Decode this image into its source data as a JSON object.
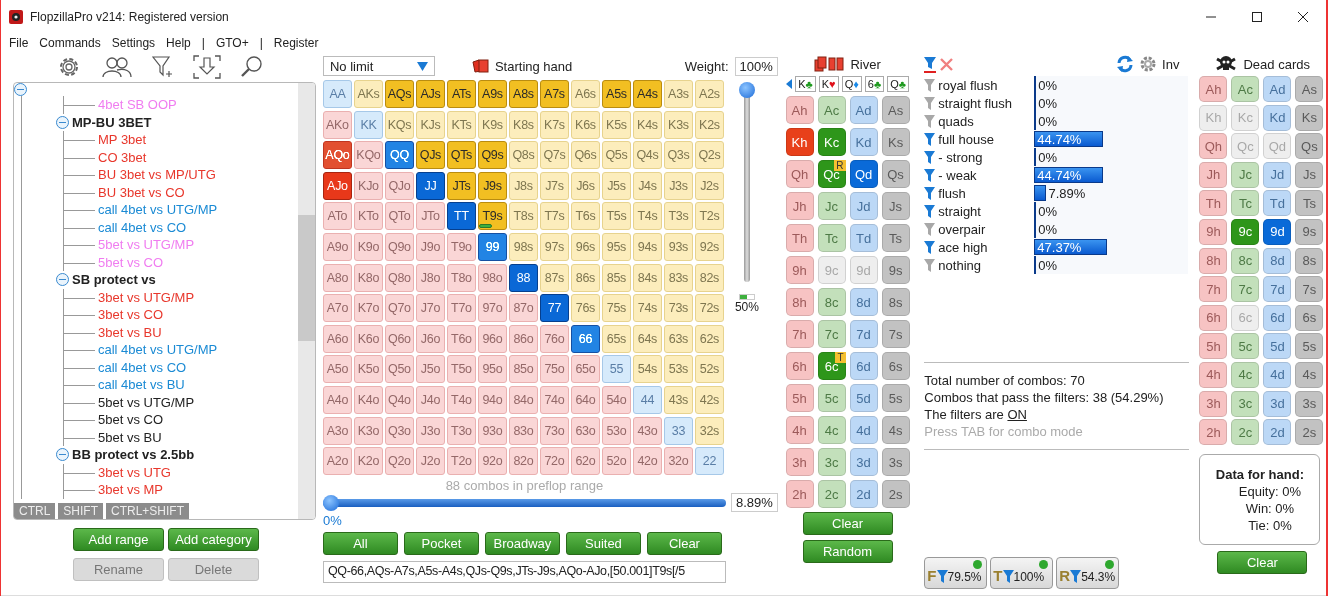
{
  "window": {
    "title": "FlopzillaPro v214: Registered version"
  },
  "menu": [
    "File",
    "Commands",
    "Settings",
    "Help",
    "|",
    "GTO+",
    "|",
    "Register"
  ],
  "tree": {
    "expanded": true,
    "children": [
      {
        "children": [
          {
            "label": "4bet SB OOP",
            "color": "#f07cf0"
          }
        ]
      },
      {
        "label": "MP-BU 3BET",
        "expanded": true,
        "children": [
          {
            "label": "MP 3bet",
            "color": "#e8372c"
          },
          {
            "label": "CO 3bet",
            "color": "#e8372c"
          },
          {
            "label": "BU 3bet vs MP/UTG",
            "color": "#e8372c"
          },
          {
            "label": "BU 3bet vs CO",
            "color": "#e8372c"
          },
          {
            "label": "call 4bet vs UTG/MP",
            "color": "#1a8ad4"
          },
          {
            "label": "call 4bet vs CO",
            "color": "#1a8ad4"
          },
          {
            "label": "5bet vs UTG/MP",
            "color": "#f07cf0"
          },
          {
            "label": "5bet vs CO",
            "color": "#f07cf0"
          }
        ]
      },
      {
        "label": "SB protect vs",
        "expanded": true,
        "children": [
          {
            "label": "3bet vs UTG/MP",
            "color": "#e8372c"
          },
          {
            "label": "3bet vs CO",
            "color": "#e8372c"
          },
          {
            "label": "3bet vs BU",
            "color": "#e8372c"
          },
          {
            "label": "call 4bet vs UTG/MP",
            "color": "#1a8ad4"
          },
          {
            "label": "call 4bet vs CO",
            "color": "#1a8ad4"
          },
          {
            "label": "call 4bet vs BU",
            "color": "#1a8ad4"
          },
          {
            "label": "5bet vs UTG/MP",
            "color": "#222222"
          },
          {
            "label": "5bet vs CO",
            "color": "#222222"
          },
          {
            "label": "5bet vs BU",
            "color": "#222222"
          }
        ]
      },
      {
        "label": "BB protect vs 2.5bb",
        "expanded": true,
        "children": [
          {
            "label": "3bet vs UTG",
            "color": "#e8372c"
          },
          {
            "label": "3bet vs MP",
            "color": "#e8372c"
          }
        ]
      }
    ]
  },
  "modifier_tabs": [
    "CTRL",
    "SHIFT",
    "CTRL+SHIFT"
  ],
  "tree_buttons": [
    {
      "label": "Add range",
      "disabled": false
    },
    {
      "label": "Add category",
      "disabled": false
    },
    {
      "label": "Rename",
      "disabled": true
    },
    {
      "label": "Delete",
      "disabled": true
    }
  ],
  "game_select": {
    "value": "No limit"
  },
  "starting_hand_label": "Starting hand",
  "weight": {
    "label": "Weight:",
    "value": "100%"
  },
  "weight_slider": {
    "level": 1
  },
  "weight_mini": {
    "level": 0.5,
    "reading": "50%"
  },
  "hand_grid": [
    [
      {
        "label": "AA",
        "selected": false,
        "partial": false
      },
      {
        "label": "AKs",
        "selected": false,
        "partial": false
      },
      {
        "label": "AQs",
        "selected": true,
        "partial": false
      },
      {
        "label": "AJs",
        "selected": true,
        "partial": false
      },
      {
        "label": "ATs",
        "selected": true,
        "partial": false
      },
      {
        "label": "A9s",
        "selected": true,
        "partial": false
      },
      {
        "label": "A8s",
        "selected": true,
        "partial": false
      },
      {
        "label": "A7s",
        "selected": true,
        "partial": false
      },
      {
        "label": "A6s",
        "selected": false,
        "partial": false
      },
      {
        "label": "A5s",
        "selected": true,
        "partial": false
      },
      {
        "label": "A4s",
        "selected": true,
        "partial": false
      },
      {
        "label": "A3s",
        "selected": false,
        "partial": false
      },
      {
        "label": "A2s",
        "selected": false,
        "partial": false
      }
    ],
    [
      {
        "label": "AKo",
        "selected": false,
        "partial": false
      },
      {
        "label": "KK",
        "selected": false,
        "partial": false
      },
      {
        "label": "KQs",
        "selected": false,
        "partial": false
      },
      {
        "label": "KJs",
        "selected": false,
        "partial": false
      },
      {
        "label": "KTs",
        "selected": false,
        "partial": false
      },
      {
        "label": "K9s",
        "selected": false,
        "partial": false
      },
      {
        "label": "K8s",
        "selected": false,
        "partial": false
      },
      {
        "label": "K7s",
        "selected": false,
        "partial": false
      },
      {
        "label": "K6s",
        "selected": false,
        "partial": false
      },
      {
        "label": "K5s",
        "selected": false,
        "partial": false
      },
      {
        "label": "K4s",
        "selected": false,
        "partial": false
      },
      {
        "label": "K3s",
        "selected": false,
        "partial": false
      },
      {
        "label": "K2s",
        "selected": false,
        "partial": false
      }
    ],
    [
      {
        "label": "AQo",
        "selected": true,
        "partial": true
      },
      {
        "label": "KQo",
        "selected": false,
        "partial": false
      },
      {
        "label": "QQ",
        "selected": true,
        "partial": true
      },
      {
        "label": "QJs",
        "selected": true,
        "partial": false
      },
      {
        "label": "QTs",
        "selected": true,
        "partial": false
      },
      {
        "label": "Q9s",
        "selected": true,
        "partial": false
      },
      {
        "label": "Q8s",
        "selected": false,
        "partial": false
      },
      {
        "label": "Q7s",
        "selected": false,
        "partial": false
      },
      {
        "label": "Q6s",
        "selected": false,
        "partial": false
      },
      {
        "label": "Q5s",
        "selected": false,
        "partial": false
      },
      {
        "label": "Q4s",
        "selected": false,
        "partial": false
      },
      {
        "label": "Q3s",
        "selected": false,
        "partial": false
      },
      {
        "label": "Q2s",
        "selected": false,
        "partial": false
      }
    ],
    [
      {
        "label": "AJo",
        "selected": true,
        "partial": false
      },
      {
        "label": "KJo",
        "selected": false,
        "partial": false
      },
      {
        "label": "QJo",
        "selected": false,
        "partial": false
      },
      {
        "label": "JJ",
        "selected": true,
        "partial": false
      },
      {
        "label": "JTs",
        "selected": true,
        "partial": false
      },
      {
        "label": "J9s",
        "selected": true,
        "partial": false
      },
      {
        "label": "J8s",
        "selected": false,
        "partial": false
      },
      {
        "label": "J7s",
        "selected": false,
        "partial": false
      },
      {
        "label": "J6s",
        "selected": false,
        "partial": false
      },
      {
        "label": "J5s",
        "selected": false,
        "partial": false
      },
      {
        "label": "J4s",
        "selected": false,
        "partial": false
      },
      {
        "label": "J3s",
        "selected": false,
        "partial": false
      },
      {
        "label": "J2s",
        "selected": false,
        "partial": false
      }
    ],
    [
      {
        "label": "ATo",
        "selected": false,
        "partial": false
      },
      {
        "label": "KTo",
        "selected": false,
        "partial": false
      },
      {
        "label": "QTo",
        "selected": false,
        "partial": false
      },
      {
        "label": "JTo",
        "selected": false,
        "partial": false
      },
      {
        "label": "TT",
        "selected": true,
        "partial": false
      },
      {
        "label": "T9s",
        "selected": true,
        "partial": false,
        "level": 0.5
      },
      {
        "label": "T8s",
        "selected": false,
        "partial": false
      },
      {
        "label": "T7s",
        "selected": false,
        "partial": false
      },
      {
        "label": "T6s",
        "selected": false,
        "partial": false
      },
      {
        "label": "T5s",
        "selected": false,
        "partial": false
      },
      {
        "label": "T4s",
        "selected": false,
        "partial": false
      },
      {
        "label": "T3s",
        "selected": false,
        "partial": false
      },
      {
        "label": "T2s",
        "selected": false,
        "partial": false
      }
    ],
    [
      {
        "label": "A9o",
        "selected": false,
        "partial": false
      },
      {
        "label": "K9o",
        "selected": false,
        "partial": false
      },
      {
        "label": "Q9o",
        "selected": false,
        "partial": false
      },
      {
        "label": "J9o",
        "selected": false,
        "partial": false
      },
      {
        "label": "T9o",
        "selected": false,
        "partial": false
      },
      {
        "label": "99",
        "selected": true,
        "partial": true
      },
      {
        "label": "98s",
        "selected": false,
        "partial": false
      },
      {
        "label": "97s",
        "selected": false,
        "partial": false
      },
      {
        "label": "96s",
        "selected": false,
        "partial": false
      },
      {
        "label": "95s",
        "selected": false,
        "partial": false
      },
      {
        "label": "94s",
        "selected": false,
        "partial": false
      },
      {
        "label": "93s",
        "selected": false,
        "partial": false
      },
      {
        "label": "92s",
        "selected": false,
        "partial": false
      }
    ],
    [
      {
        "label": "A8o",
        "selected": false,
        "partial": false
      },
      {
        "label": "K8o",
        "selected": false,
        "partial": false
      },
      {
        "label": "Q8o",
        "selected": false,
        "partial": false
      },
      {
        "label": "J8o",
        "selected": false,
        "partial": false
      },
      {
        "label": "T8o",
        "selected": false,
        "partial": false
      },
      {
        "label": "98o",
        "selected": false,
        "partial": false
      },
      {
        "label": "88",
        "selected": true,
        "partial": false
      },
      {
        "label": "87s",
        "selected": false,
        "partial": false
      },
      {
        "label": "86s",
        "selected": false,
        "partial": false
      },
      {
        "label": "85s",
        "selected": false,
        "partial": false
      },
      {
        "label": "84s",
        "selected": false,
        "partial": false
      },
      {
        "label": "83s",
        "selected": false,
        "partial": false
      },
      {
        "label": "82s",
        "selected": false,
        "partial": false
      }
    ],
    [
      {
        "label": "A7o",
        "selected": false,
        "partial": false
      },
      {
        "label": "K7o",
        "selected": false,
        "partial": false
      },
      {
        "label": "Q7o",
        "selected": false,
        "partial": false
      },
      {
        "label": "J7o",
        "selected": false,
        "partial": false
      },
      {
        "label": "T7o",
        "selected": false,
        "partial": false
      },
      {
        "label": "97o",
        "selected": false,
        "partial": false
      },
      {
        "label": "87o",
        "selected": false,
        "partial": false
      },
      {
        "label": "77",
        "selected": true,
        "partial": false
      },
      {
        "label": "76s",
        "selected": false,
        "partial": false
      },
      {
        "label": "75s",
        "selected": false,
        "partial": false
      },
      {
        "label": "74s",
        "selected": false,
        "partial": false
      },
      {
        "label": "73s",
        "selected": false,
        "partial": false
      },
      {
        "label": "72s",
        "selected": false,
        "partial": false
      }
    ],
    [
      {
        "label": "A6o",
        "selected": false,
        "partial": false
      },
      {
        "label": "K6o",
        "selected": false,
        "partial": false
      },
      {
        "label": "Q6o",
        "selected": false,
        "partial": false
      },
      {
        "label": "J6o",
        "selected": false,
        "partial": false
      },
      {
        "label": "T6o",
        "selected": false,
        "partial": false
      },
      {
        "label": "96o",
        "selected": false,
        "partial": false
      },
      {
        "label": "86o",
        "selected": false,
        "partial": false
      },
      {
        "label": "76o",
        "selected": false,
        "partial": false
      },
      {
        "label": "66",
        "selected": true,
        "partial": true
      },
      {
        "label": "65s",
        "selected": false,
        "partial": false
      },
      {
        "label": "64s",
        "selected": false,
        "partial": false
      },
      {
        "label": "63s",
        "selected": false,
        "partial": false
      },
      {
        "label": "62s",
        "selected": false,
        "partial": false
      }
    ],
    [
      {
        "label": "A5o",
        "selected": false,
        "partial": false
      },
      {
        "label": "K5o",
        "selected": false,
        "partial": false
      },
      {
        "label": "Q5o",
        "selected": false,
        "partial": false
      },
      {
        "label": "J5o",
        "selected": false,
        "partial": false
      },
      {
        "label": "T5o",
        "selected": false,
        "partial": false
      },
      {
        "label": "95o",
        "selected": false,
        "partial": false
      },
      {
        "label": "85o",
        "selected": false,
        "partial": false
      },
      {
        "label": "75o",
        "selected": false,
        "partial": false
      },
      {
        "label": "65o",
        "selected": false,
        "partial": false
      },
      {
        "label": "55",
        "selected": false,
        "partial": false
      },
      {
        "label": "54s",
        "selected": false,
        "partial": false
      },
      {
        "label": "53s",
        "selected": false,
        "partial": false
      },
      {
        "label": "52s",
        "selected": false,
        "partial": false
      }
    ],
    [
      {
        "label": "A4o",
        "selected": false,
        "partial": false
      },
      {
        "label": "K4o",
        "selected": false,
        "partial": false
      },
      {
        "label": "Q4o",
        "selected": false,
        "partial": false
      },
      {
        "label": "J4o",
        "selected": false,
        "partial": false
      },
      {
        "label": "T4o",
        "selected": false,
        "partial": false
      },
      {
        "label": "94o",
        "selected": false,
        "partial": false
      },
      {
        "label": "84o",
        "selected": false,
        "partial": false
      },
      {
        "label": "74o",
        "selected": false,
        "partial": false
      },
      {
        "label": "64o",
        "selected": false,
        "partial": false
      },
      {
        "label": "54o",
        "selected": false,
        "partial": false
      },
      {
        "label": "44",
        "selected": false,
        "partial": false
      },
      {
        "label": "43s",
        "selected": false,
        "partial": false
      },
      {
        "label": "42s",
        "selected": false,
        "partial": false
      }
    ],
    [
      {
        "label": "A3o",
        "selected": false,
        "partial": false
      },
      {
        "label": "K3o",
        "selected": false,
        "partial": false
      },
      {
        "label": "Q3o",
        "selected": false,
        "partial": false
      },
      {
        "label": "J3o",
        "selected": false,
        "partial": false
      },
      {
        "label": "T3o",
        "selected": false,
        "partial": false
      },
      {
        "label": "93o",
        "selected": false,
        "partial": false
      },
      {
        "label": "83o",
        "selected": false,
        "partial": false
      },
      {
        "label": "73o",
        "selected": false,
        "partial": false
      },
      {
        "label": "63o",
        "selected": false,
        "partial": false
      },
      {
        "label": "53o",
        "selected": false,
        "partial": false
      },
      {
        "label": "43o",
        "selected": false,
        "partial": false
      },
      {
        "label": "33",
        "selected": false,
        "partial": false
      },
      {
        "label": "32s",
        "selected": false,
        "partial": false
      }
    ],
    [
      {
        "label": "A2o",
        "selected": false,
        "partial": false
      },
      {
        "label": "K2o",
        "selected": false,
        "partial": false
      },
      {
        "label": "Q2o",
        "selected": false,
        "partial": false
      },
      {
        "label": "J2o",
        "selected": false,
        "partial": false
      },
      {
        "label": "T2o",
        "selected": false,
        "partial": false
      },
      {
        "label": "92o",
        "selected": false,
        "partial": false
      },
      {
        "label": "82o",
        "selected": false,
        "partial": false
      },
      {
        "label": "72o",
        "selected": false,
        "partial": false
      },
      {
        "label": "62o",
        "selected": false,
        "partial": false
      },
      {
        "label": "52o",
        "selected": false,
        "partial": false
      },
      {
        "label": "42o",
        "selected": false,
        "partial": false
      },
      {
        "label": "32o",
        "selected": false,
        "partial": false
      },
      {
        "label": "22",
        "selected": false,
        "partial": false
      }
    ]
  ],
  "range_caption": "88 combos in preflop range",
  "range_slider": {
    "level": 0,
    "min_label": "0%",
    "value": "8.89%"
  },
  "range_buttons": [
    "All",
    "Pocket",
    "Broadway",
    "Suited",
    "Clear"
  ],
  "range_text": "QQ-66,AQs-A7s,A5s-A4s,QJs-Q9s,JTs-J9s,AQo-AJo,[50.001]T9s[/5",
  "board": {
    "street": "River",
    "slots": [
      {
        "rank": "K",
        "suit": "♣",
        "color": "#1f9a1f"
      },
      {
        "rank": "K",
        "suit": "♥",
        "color": "#e0101a"
      },
      {
        "rank": "Q",
        "suit": "♦",
        "color": "#1a8ae8"
      },
      {
        "rank": "6",
        "suit": "♣",
        "color": "#1f9a1f"
      },
      {
        "rank": "Q",
        "suit": "♣",
        "color": "#1f9a1f"
      }
    ],
    "rows": [
      [
        {
          "label": "Ah",
          "selected": false,
          "disabled": false
        },
        {
          "label": "Ac",
          "selected": false,
          "disabled": false
        },
        {
          "label": "Ad",
          "selected": false,
          "disabled": false
        },
        {
          "label": "As",
          "selected": false,
          "disabled": false
        }
      ],
      [
        {
          "label": "Kh",
          "selected": true,
          "disabled": false
        },
        {
          "label": "Kc",
          "selected": true,
          "disabled": false
        },
        {
          "label": "Kd",
          "selected": false,
          "disabled": false
        },
        {
          "label": "Ks",
          "selected": false,
          "disabled": false
        }
      ],
      [
        {
          "label": "Qh",
          "selected": false,
          "disabled": false
        },
        {
          "label": "Qc",
          "selected": true,
          "disabled": false,
          "badge": "R"
        },
        {
          "label": "Qd",
          "selected": true,
          "disabled": false
        },
        {
          "label": "Qs",
          "selected": false,
          "disabled": false
        }
      ],
      [
        {
          "label": "Jh",
          "selected": false,
          "disabled": false
        },
        {
          "label": "Jc",
          "selected": false,
          "disabled": false
        },
        {
          "label": "Jd",
          "selected": false,
          "disabled": false
        },
        {
          "label": "Js",
          "selected": false,
          "disabled": false
        }
      ],
      [
        {
          "label": "Th",
          "selected": false,
          "disabled": false
        },
        {
          "label": "Tc",
          "selected": false,
          "disabled": false
        },
        {
          "label": "Td",
          "selected": false,
          "disabled": false
        },
        {
          "label": "Ts",
          "selected": false,
          "disabled": false
        }
      ],
      [
        {
          "label": "9h",
          "selected": false,
          "disabled": false
        },
        {
          "label": "9c",
          "selected": false,
          "disabled": true
        },
        {
          "label": "9d",
          "selected": false,
          "disabled": true
        },
        {
          "label": "9s",
          "selected": false,
          "disabled": false
        }
      ],
      [
        {
          "label": "8h",
          "selected": false,
          "disabled": false
        },
        {
          "label": "8c",
          "selected": false,
          "disabled": false
        },
        {
          "label": "8d",
          "selected": false,
          "disabled": false
        },
        {
          "label": "8s",
          "selected": false,
          "disabled": false
        }
      ],
      [
        {
          "label": "7h",
          "selected": false,
          "disabled": false
        },
        {
          "label": "7c",
          "selected": false,
          "disabled": false
        },
        {
          "label": "7d",
          "selected": false,
          "disabled": false
        },
        {
          "label": "7s",
          "selected": false,
          "disabled": false
        }
      ],
      [
        {
          "label": "6h",
          "selected": false,
          "disabled": false
        },
        {
          "label": "6c",
          "selected": true,
          "disabled": false,
          "badge": "T"
        },
        {
          "label": "6d",
          "selected": false,
          "disabled": false
        },
        {
          "label": "6s",
          "selected": false,
          "disabled": false
        }
      ],
      [
        {
          "label": "5h",
          "selected": false,
          "disabled": false
        },
        {
          "label": "5c",
          "selected": false,
          "disabled": false
        },
        {
          "label": "5d",
          "selected": false,
          "disabled": false
        },
        {
          "label": "5s",
          "selected": false,
          "disabled": false
        }
      ],
      [
        {
          "label": "4h",
          "selected": false,
          "disabled": false
        },
        {
          "label": "4c",
          "selected": false,
          "disabled": false
        },
        {
          "label": "4d",
          "selected": false,
          "disabled": false
        },
        {
          "label": "4s",
          "selected": false,
          "disabled": false
        }
      ],
      [
        {
          "label": "3h",
          "selected": false,
          "disabled": false
        },
        {
          "label": "3c",
          "selected": false,
          "disabled": false
        },
        {
          "label": "3d",
          "selected": false,
          "disabled": false
        },
        {
          "label": "3s",
          "selected": false,
          "disabled": false
        }
      ],
      [
        {
          "label": "2h",
          "selected": false,
          "disabled": false
        },
        {
          "label": "2c",
          "selected": false,
          "disabled": false
        },
        {
          "label": "2d",
          "selected": false,
          "disabled": false
        },
        {
          "label": "2s",
          "selected": false,
          "disabled": false
        }
      ]
    ],
    "buttons": [
      "Clear",
      "Random"
    ]
  },
  "filters": {
    "inv_label": "Inv",
    "items": [
      {
        "label": "royal flush",
        "active": false,
        "value": "0%",
        "level": 0
      },
      {
        "label": "straight flush",
        "active": false,
        "value": "0%",
        "level": 0
      },
      {
        "label": "quads",
        "active": false,
        "value": "0%",
        "level": 0
      },
      {
        "label": "full house",
        "active": true,
        "value": "44.74%",
        "level": 0.4474
      },
      {
        "label": "- strong",
        "active": true,
        "value": "0%",
        "level": 0
      },
      {
        "label": "- weak",
        "active": true,
        "value": "44.74%",
        "level": 0.4474
      },
      {
        "label": "flush",
        "active": true,
        "value": "7.89%",
        "level": 0.0789
      },
      {
        "label": "straight",
        "active": true,
        "value": "0%",
        "level": 0
      },
      {
        "label": "overpair",
        "active": false,
        "value": "0%",
        "level": 0
      },
      {
        "label": "ace high",
        "active": true,
        "value": "47.37%",
        "level": 0.4737
      },
      {
        "label": "nothing",
        "active": false,
        "value": "0%",
        "level": 0
      }
    ],
    "total": "Total number of combos: 70",
    "pass": "Combos that pass the filters: 38 (54.29%)",
    "filters_prefix": "The filters are",
    "filters_status": "ON",
    "hint": "Press TAB for combo mode",
    "street_filters": [
      {
        "letter": "F",
        "value": "79.5%",
        "on": true
      },
      {
        "letter": "T",
        "value": "100%",
        "on": true
      },
      {
        "letter": "R",
        "value": "54.3%",
        "on": true
      }
    ]
  },
  "dead": {
    "title": "Dead cards",
    "rows": [
      [
        {
          "label": "Ah",
          "selected": false,
          "disabled": false
        },
        {
          "label": "Ac",
          "selected": false,
          "disabled": false
        },
        {
          "label": "Ad",
          "selected": false,
          "disabled": false
        },
        {
          "label": "As",
          "selected": false,
          "disabled": false
        }
      ],
      [
        {
          "label": "Kh",
          "selected": false,
          "disabled": true
        },
        {
          "label": "Kc",
          "selected": false,
          "disabled": true
        },
        {
          "label": "Kd",
          "selected": false,
          "disabled": false
        },
        {
          "label": "Ks",
          "selected": false,
          "disabled": false
        }
      ],
      [
        {
          "label": "Qh",
          "selected": false,
          "disabled": false
        },
        {
          "label": "Qc",
          "selected": false,
          "disabled": true
        },
        {
          "label": "Qd",
          "selected": false,
          "disabled": true
        },
        {
          "label": "Qs",
          "selected": false,
          "disabled": false
        }
      ],
      [
        {
          "label": "Jh",
          "selected": false,
          "disabled": false
        },
        {
          "label": "Jc",
          "selected": false,
          "disabled": false
        },
        {
          "label": "Jd",
          "selected": false,
          "disabled": false
        },
        {
          "label": "Js",
          "selected": false,
          "disabled": false
        }
      ],
      [
        {
          "label": "Th",
          "selected": false,
          "disabled": false
        },
        {
          "label": "Tc",
          "selected": false,
          "disabled": false
        },
        {
          "label": "Td",
          "selected": false,
          "disabled": false
        },
        {
          "label": "Ts",
          "selected": false,
          "disabled": false
        }
      ],
      [
        {
          "label": "9h",
          "selected": false,
          "disabled": false
        },
        {
          "label": "9c",
          "selected": true,
          "disabled": false
        },
        {
          "label": "9d",
          "selected": true,
          "disabled": false
        },
        {
          "label": "9s",
          "selected": false,
          "disabled": false
        }
      ],
      [
        {
          "label": "8h",
          "selected": false,
          "disabled": false
        },
        {
          "label": "8c",
          "selected": false,
          "disabled": false
        },
        {
          "label": "8d",
          "selected": false,
          "disabled": false
        },
        {
          "label": "8s",
          "selected": false,
          "disabled": false
        }
      ],
      [
        {
          "label": "7h",
          "selected": false,
          "disabled": false
        },
        {
          "label": "7c",
          "selected": false,
          "disabled": false
        },
        {
          "label": "7d",
          "selected": false,
          "disabled": false
        },
        {
          "label": "7s",
          "selected": false,
          "disabled": false
        }
      ],
      [
        {
          "label": "6h",
          "selected": false,
          "disabled": false
        },
        {
          "label": "6c",
          "selected": false,
          "disabled": true
        },
        {
          "label": "6d",
          "selected": false,
          "disabled": false
        },
        {
          "label": "6s",
          "selected": false,
          "disabled": false
        }
      ],
      [
        {
          "label": "5h",
          "selected": false,
          "disabled": false
        },
        {
          "label": "5c",
          "selected": false,
          "disabled": false
        },
        {
          "label": "5d",
          "selected": false,
          "disabled": false
        },
        {
          "label": "5s",
          "selected": false,
          "disabled": false
        }
      ],
      [
        {
          "label": "4h",
          "selected": false,
          "disabled": false
        },
        {
          "label": "4c",
          "selected": false,
          "disabled": false
        },
        {
          "label": "4d",
          "selected": false,
          "disabled": false
        },
        {
          "label": "4s",
          "selected": false,
          "disabled": false
        }
      ],
      [
        {
          "label": "3h",
          "selected": false,
          "disabled": false
        },
        {
          "label": "3c",
          "selected": false,
          "disabled": false
        },
        {
          "label": "3d",
          "selected": false,
          "disabled": false
        },
        {
          "label": "3s",
          "selected": false,
          "disabled": false
        }
      ],
      [
        {
          "label": "2h",
          "selected": false,
          "disabled": false
        },
        {
          "label": "2c",
          "selected": false,
          "disabled": false
        },
        {
          "label": "2d",
          "selected": false,
          "disabled": false
        },
        {
          "label": "2s",
          "selected": false,
          "disabled": false
        }
      ]
    ],
    "data_box": {
      "title": "Data for hand:",
      "lines": [
        "Equity: 0%",
        "Win: 0%",
        "Tie: 0%"
      ]
    },
    "button": "Clear"
  }
}
